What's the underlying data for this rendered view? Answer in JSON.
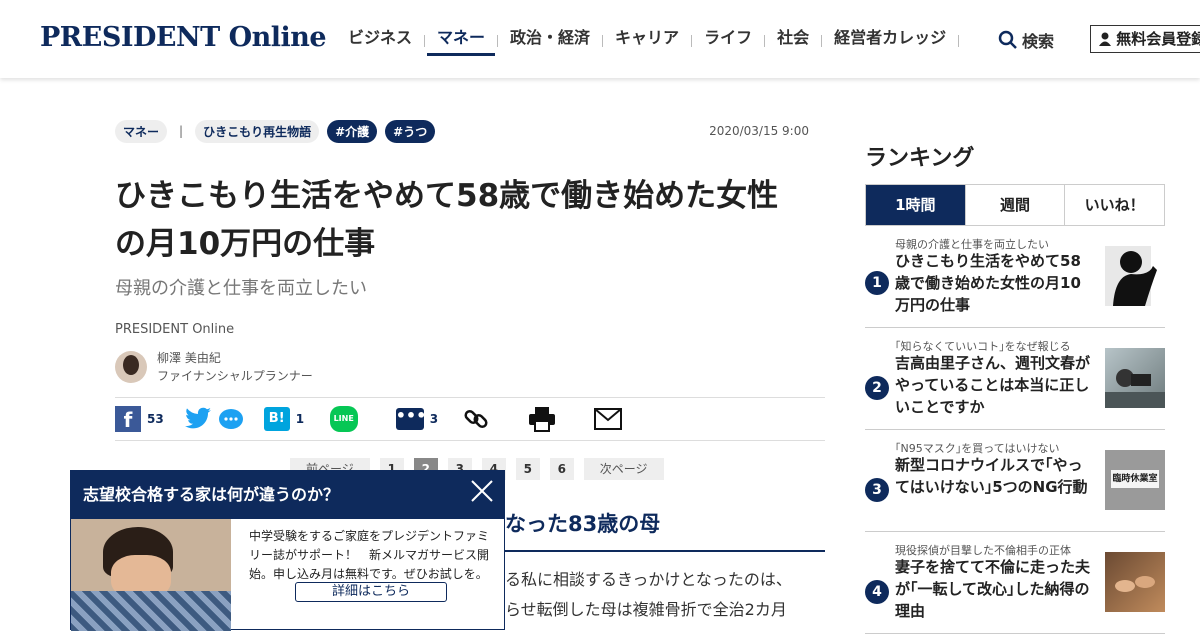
{
  "header": {
    "logo": "PRESIDENT Online",
    "nav": [
      "ビジネス",
      "マネー",
      "政治・経済",
      "キャリア",
      "ライフ",
      "社会",
      "経営者カレッジ"
    ],
    "search_label": "検索",
    "member_label": "無料会員登録"
  },
  "article": {
    "tags": [
      "マネー",
      "ひきこもり再生物語",
      "#介護",
      "#うつ"
    ],
    "date": "2020/03/15 9:00",
    "title_line1": "ひきこもり生活をやめて58歳で働き始めた女性",
    "title_line2": "の月10万円の仕事",
    "subtitle": "母親の介護と仕事を両立したい",
    "source": "PRESIDENT Online",
    "author_name": "柳澤 美由紀",
    "author_role": "ファイナンシャルプランナー",
    "share_counts": {
      "facebook": "53",
      "hatena": "1",
      "comments": "3"
    },
    "pager": {
      "prev": "前ページ",
      "next": "次ページ",
      "pages": [
        "1",
        "2",
        "3",
        "4",
        "5",
        "6"
      ],
      "current": "2"
    },
    "section_heading": "なった83歳の母",
    "body_line1": "る私に相談するきっかけとなったのは、",
    "body_line2": "らせ転倒した母は複雑骨折で全治2カ月"
  },
  "popup": {
    "title": "志望校合格する家は何が違うのか？",
    "text": "中学受験をするご家庭をプレジデントファミリー誌がサポート！　新メルマガサービス開始。申し込み月は無料です。ぜひお試しを。",
    "button": "詳細はこちら"
  },
  "sidebar": {
    "title": "ランキング",
    "tabs": [
      "1時間",
      "週間",
      "いいね！"
    ],
    "items": [
      {
        "num": "1",
        "kicker": "母親の介護と仕事を両立したい",
        "text": "ひきこもり生活をやめて58歳で働き始めた女性の月10万円の仕事"
      },
      {
        "num": "2",
        "kicker": "｢知らなくていいコト｣をなぜ報じる",
        "text": "吉高由里子さん、週刊文春がやっていることは本当に正しいことですか"
      },
      {
        "num": "3",
        "kicker": "｢N95マスク｣を買ってはいけない",
        "text": "新型コロナウイルスで｢やってはいけない｣5つのNG行動"
      },
      {
        "num": "4",
        "kicker": "現役探偵が目撃した不倫相手の正体",
        "text": "妻子を捨てて不倫に走った夫が｢一転して改心｣した納得の理由"
      }
    ],
    "thumb3_label": "臨時休業室"
  }
}
